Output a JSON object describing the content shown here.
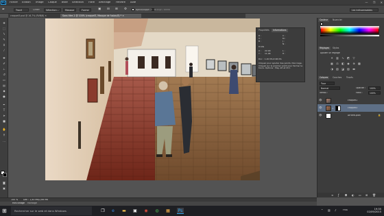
{
  "app": {
    "logo": "Ps",
    "menu": [
      "Fichier",
      "Edition",
      "Image",
      "Calque",
      "Texte",
      "Sélection",
      "Filtre",
      "Affichage",
      "Fenêtre",
      "Aide"
    ],
    "window_controls": [
      "—",
      "❐",
      "✕"
    ]
  },
  "options_bar": {
    "mode": "Tracé",
    "create_label": "Créer:",
    "selection_btn": "Sélection...",
    "mask_btn": "Masque",
    "shape_btn": "Forme",
    "auto_add_delete": "Ajout/Suppr. auto",
    "align_edges": "Align. bords",
    "workspace": "Les indispensables"
  },
  "tabs": [
    {
      "label": "croquet3.psd @ 16,7% (RVB/8) ✕",
      "active": false
    },
    {
      "label": "Sans titre-1 @ 100% (croquet3, Masque de fusion/8) * ✕",
      "active": true
    }
  ],
  "info_panel": {
    "tabs": [
      "Propriétés",
      "Informations"
    ],
    "rgb_labels": [
      "R :",
      "V :",
      "B :"
    ],
    "cmyk_labels": [
      "C :",
      "M :",
      "J :",
      "N :"
    ],
    "bits": "8 bits",
    "x_label": "X :",
    "y_label": "Y :",
    "x_val": "22,99",
    "y_val": "11,06",
    "w_label": "L :",
    "h_label": "H :",
    "doc_size": "Doc : 1,40 Mo/2,66 Mo",
    "hint": "Cliquez pour ajouter des points d'ancrage. Cliquez sur le premier point pour fermer le tracé. Options : Maj, Alt et Ctrl."
  },
  "right_panel": {
    "color_tabs": [
      "Couleur",
      "Nuancier"
    ],
    "adjust_tabs": [
      "Réglages",
      "Styles"
    ],
    "adjust_title": "Ajouter un réglage",
    "layers_tabs": [
      "Calques",
      "Couches",
      "Tracés"
    ],
    "kind_filter": "Type",
    "blend_mode": "Normal",
    "opacity_label": "Opacité :",
    "opacity": "100%",
    "lock_label": "Verrou :",
    "fill_label": "Fond :",
    "fill": "100%",
    "layers": [
      {
        "name": "croquet1",
        "selected": false,
        "thumb": "photo"
      },
      {
        "name": "croquet3",
        "selected": true,
        "thumb": "masked"
      },
      {
        "name": "Arrière-plan",
        "selected": false,
        "thumb": "white"
      }
    ]
  },
  "status": {
    "zoom": "100 %",
    "doc": "Doc : 1,40 Mo/2,66 Mo"
  },
  "bottom_tabs": [
    "Mini Bridge",
    "Montage"
  ],
  "taskbar": {
    "search_placeholder": "Rechercher sur le web et dans Windows",
    "language": "FRA",
    "time": "19:35",
    "date": "02/09/2015"
  },
  "colors": {
    "ps_blue": "#2fa3e6",
    "selected_layer": "#5e6f86",
    "taskbar": "#1e1f23"
  }
}
